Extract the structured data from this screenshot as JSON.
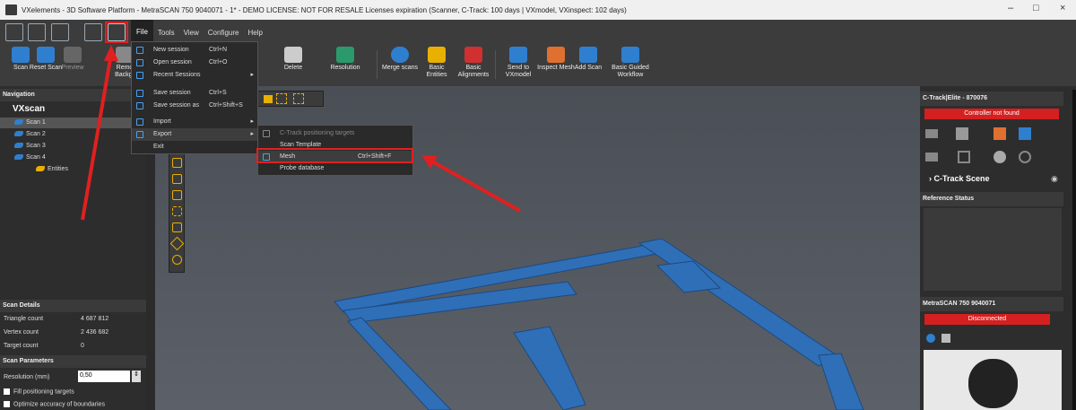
{
  "window": {
    "title": "VXelements - 3D Software Platform - MetraSCAN 750 9040071 - 1* - DEMO LICENSE: NOT FOR RESALE Licenses expiration (Scanner, C-Track: 100 days | VXmodel, VXinspect: 102 days)",
    "minimize": "–",
    "maximize": "□",
    "close": "×"
  },
  "menubar": [
    "File",
    "Tools",
    "View",
    "Configure",
    "Help"
  ],
  "toolbar": {
    "tools": [
      {
        "label": "Scan",
        "icon": "scan-icon"
      },
      {
        "label": "Reset Scan",
        "icon": "reset-scan-icon"
      },
      {
        "label": "Preview",
        "icon": "preview-icon"
      },
      {
        "label": "Remo Backgr",
        "icon": "remove-background-icon"
      },
      {
        "label": "Delete",
        "icon": "delete-icon"
      },
      {
        "label": "Resolution",
        "icon": "resolution-icon"
      },
      {
        "label": "Merge scans",
        "icon": "merge-scans-icon"
      },
      {
        "label": "Basic Entities",
        "icon": "basic-entities-icon"
      },
      {
        "label": "Basic Alignments",
        "icon": "basic-alignments-icon"
      },
      {
        "label": "Send to VXmodel",
        "icon": "send-to-vxmodel-icon"
      },
      {
        "label": "Inspect Mesh",
        "icon": "inspect-mesh-icon"
      },
      {
        "label": "Add Scan",
        "icon": "add-scan-icon"
      },
      {
        "label": "Basic Guided Workflow",
        "icon": "guided-workflow-icon"
      }
    ]
  },
  "file_menu": {
    "items": [
      {
        "label": "New session",
        "shortcut": "Ctrl+N"
      },
      {
        "label": "Open session",
        "shortcut": "Ctrl+O"
      },
      {
        "label": "Recent Sessions",
        "shortcut": ""
      },
      {
        "label": "Save session",
        "shortcut": "Ctrl+S"
      },
      {
        "label": "Save session as",
        "shortcut": "Ctrl+Shift+S"
      },
      {
        "label": "Import",
        "shortcut": ""
      },
      {
        "label": "Export",
        "shortcut": ""
      },
      {
        "label": "Exit",
        "shortcut": ""
      }
    ],
    "arrow": "▸"
  },
  "export_menu": {
    "items": [
      {
        "label": "C-Track positioning targets",
        "shortcut": ""
      },
      {
        "label": "Scan Template",
        "shortcut": ""
      },
      {
        "label": "Mesh",
        "shortcut": "Ctrl+Shift+F"
      },
      {
        "label": "Probe database",
        "shortcut": ""
      }
    ]
  },
  "navigation": {
    "header": "Navigation",
    "root": "VXscan",
    "items": [
      "Scan 1",
      "Scan 2",
      "Scan 3",
      "Scan 4",
      "Entities"
    ]
  },
  "scan_details": {
    "header": "Scan Details",
    "rows": [
      {
        "label": "Triangle count",
        "value": "4 687 812"
      },
      {
        "label": "Vertex count",
        "value": "2 436 682"
      },
      {
        "label": "Target count",
        "value": "0"
      }
    ]
  },
  "scan_parameters": {
    "header": "Scan Parameters",
    "resolution_label": "Resolution (mm)",
    "resolution_value": "0,50",
    "fill_targets": "Fill positioning targets",
    "optimize": "Optimize accuracy of boundaries"
  },
  "right_panel": {
    "ctrack_header": "C-Track|Elite - 870076",
    "controller_status": "Controller not found",
    "ctrack_scene": "C-Track Scene",
    "reference_header": "Reference Status",
    "scanner_header": "MetraSCAN 750 9040071",
    "scanner_status": "Disconnected"
  },
  "colors": {
    "accent_blue": "#2f7fd0",
    "red_status": "#d42020",
    "highlight_red": "#e02020"
  }
}
